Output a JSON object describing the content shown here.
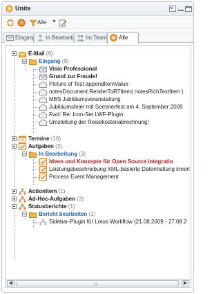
{
  "window": {
    "title": "Unite"
  },
  "toolbar": {
    "filter_label": "Alle"
  },
  "tabs": [
    {
      "label": "Eingang",
      "icon": "envelope-icon",
      "active": false
    },
    {
      "label": "In Bearbeitung",
      "icon": "person-icon",
      "active": false
    },
    {
      "label": "Im Team",
      "icon": "team-icon",
      "active": false
    },
    {
      "label": "Alle",
      "icon": "all-icon",
      "active": true
    }
  ],
  "tree": {
    "email": {
      "label": "E-Mail",
      "count": "(9)"
    },
    "eingang": {
      "label": "Eingang",
      "count": "(9)"
    },
    "mails": [
      "Visio Professional",
      "Grund zur Freude!",
      "Picture of Test appendItemValue",
      "notesDocument.RenderToRTItem( notesRichTextItem )",
      "MBS Jubiläumsveranstaltung",
      "Jubiläumsfeier mit Sommerfest am 4. September 2009",
      "Fwd: Re: Icon-Set LWF-Plugin",
      "Umstellung der Reisekostenabrechnung!"
    ],
    "termine": {
      "label": "Termine",
      "count": "(10)"
    },
    "aufgaben": {
      "label": "Aufgaben",
      "count": "(3)"
    },
    "in_bearbeitung": {
      "label": "In Bearbeitung",
      "count": "(3)"
    },
    "tasks": [
      "Ideen und Konzepte für  Open Source Integratio",
      "Leistungsbeschreibung XML-basierte Datenhaltung innerl",
      "Process Event Management"
    ],
    "action_item": {
      "label": "ActionItem",
      "count": "(1)"
    },
    "adhoc": {
      "label": "Ad-Hoc-Aufgaben",
      "count": "(3)"
    },
    "statusberichte": {
      "label": "Statusberichte",
      "count": "(1)"
    },
    "bericht": {
      "label": "Bericht bearbeiten",
      "count": "(1)"
    },
    "report_item": "Sidebar-Plugin für Lotus Workflow (21.08.2009 - 27.08.2"
  },
  "scrollbar": {
    "grip": "III"
  },
  "colors": {
    "accent_blue": "#1f5fb5",
    "task_red": "#b02020",
    "folder_orange": "#f0a43a"
  }
}
